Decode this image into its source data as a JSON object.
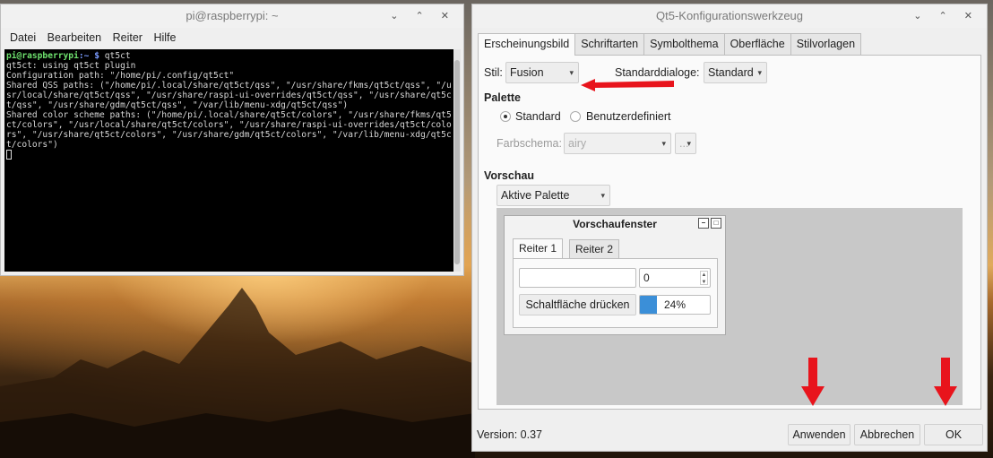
{
  "terminal": {
    "title": "pi@raspberrypi: ~",
    "menu": [
      "Datei",
      "Bearbeiten",
      "Reiter",
      "Hilfe"
    ],
    "prompt_user": "pi@raspberrypi",
    "prompt_path": ":~ $ ",
    "command": "qt5ct",
    "output": "qt5ct: using qt5ct plugin\nConfiguration path: \"/home/pi/.config/qt5ct\"\nShared QSS paths: (\"/home/pi/.local/share/qt5ct/qss\", \"/usr/share/fkms/qt5ct/qss\", \"/usr/local/share/qt5ct/qss\", \"/usr/share/raspi-ui-overrides/qt5ct/qss\", \"/usr/share/qt5ct/qss\", \"/usr/share/gdm/qt5ct/qss\", \"/var/lib/menu-xdg/qt5ct/qss\")\nShared color scheme paths: (\"/home/pi/.local/share/qt5ct/colors\", \"/usr/share/fkms/qt5ct/colors\", \"/usr/local/share/qt5ct/colors\", \"/usr/share/raspi-ui-overrides/qt5ct/colors\", \"/usr/share/qt5ct/colors\", \"/usr/share/gdm/qt5ct/colors\", \"/var/lib/menu-xdg/qt5ct/colors\")"
  },
  "qt": {
    "title": "Qt5-Konfigurationswerkzeug",
    "tabs": [
      "Erscheinungsbild",
      "Schriftarten",
      "Symbolthema",
      "Oberfläche",
      "Stilvorlagen"
    ],
    "style_label": "Stil:",
    "style_value": "Fusion",
    "dialogs_label": "Standarddialoge:",
    "dialogs_value": "Standard",
    "palette_heading": "Palette",
    "radio_standard": "Standard",
    "radio_custom": "Benutzerdefiniert",
    "scheme_label": "Farbschema:",
    "scheme_value": "airy",
    "scheme_more": "...",
    "preview_heading": "Vorschau",
    "preview_palette": "Aktive Palette",
    "preview_window_title": "Vorschaufenster",
    "preview_tab1": "Reiter 1",
    "preview_tab2": "Reiter 2",
    "spin_value": "0",
    "push_button": "Schaltfläche drücken",
    "progress_text": "24%",
    "progress_value": 0.24,
    "version": "Version: 0.37",
    "apply": "Anwenden",
    "cancel": "Abbrechen",
    "ok": "OK"
  },
  "colors": {
    "annotation_arrow": "#e8141c",
    "progress_fill": "#3b8fd8"
  }
}
